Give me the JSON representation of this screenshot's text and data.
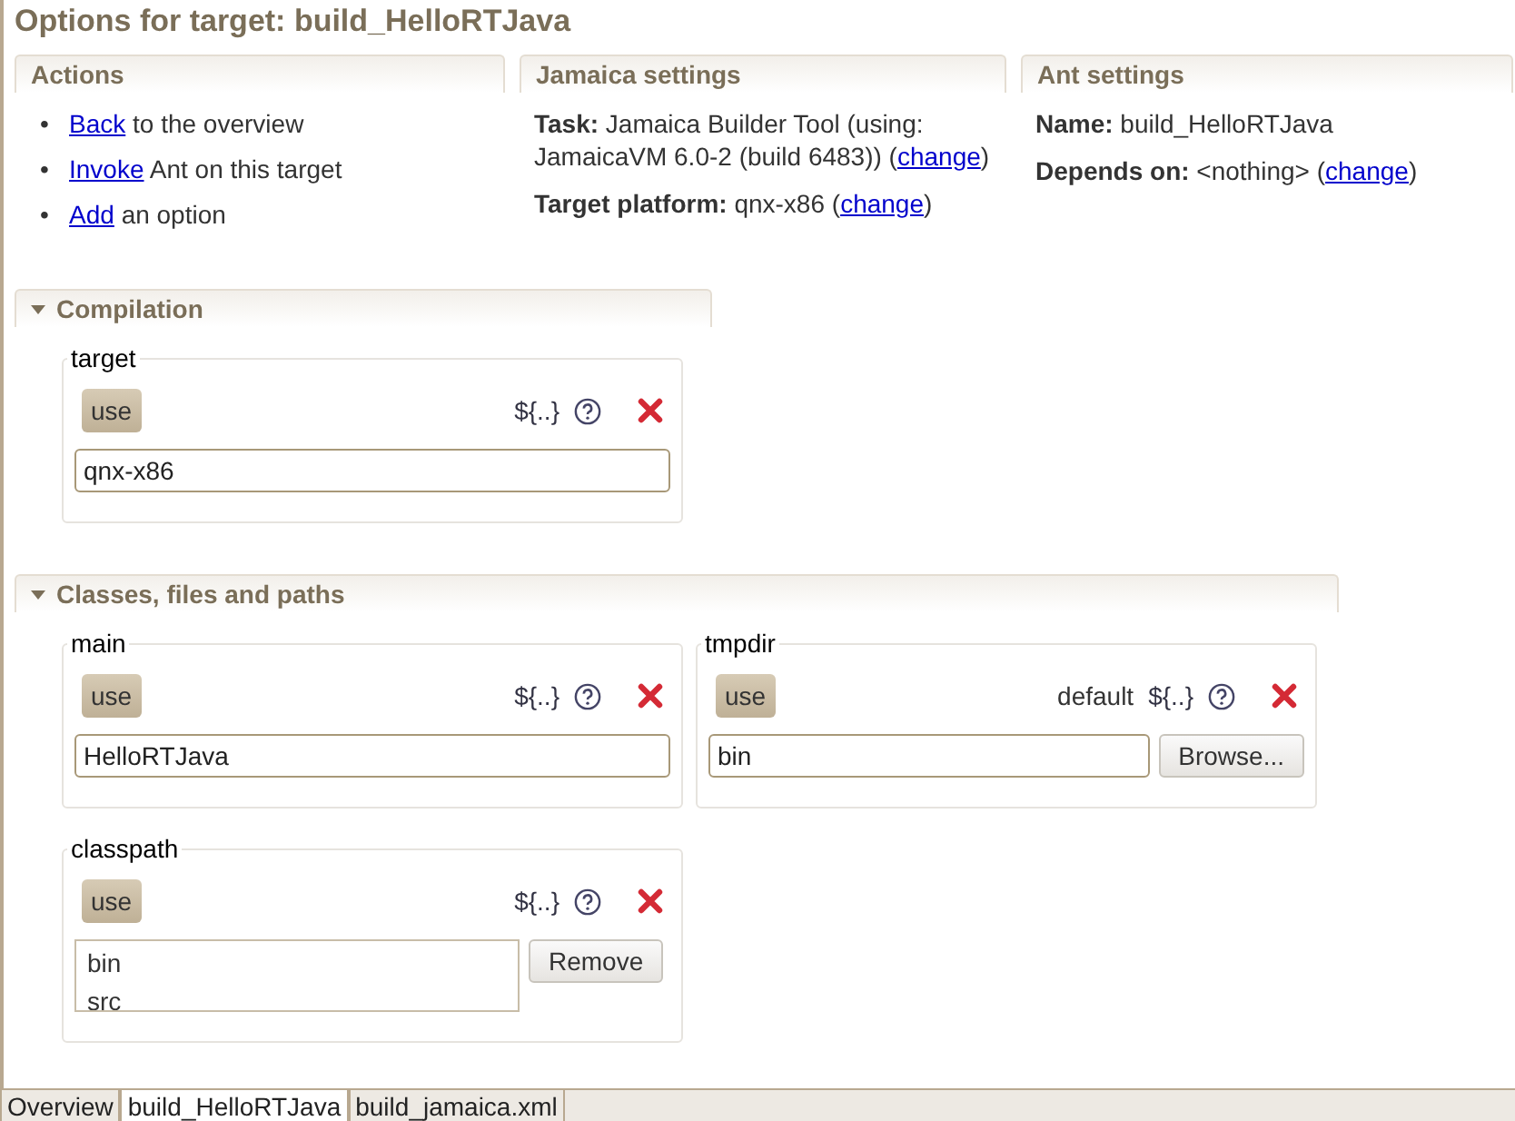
{
  "title": "Options for target: build_HelloRTJava",
  "actions": {
    "heading": "Actions",
    "items": [
      {
        "bullet": "•",
        "link": "Back",
        "text": "to the overview"
      },
      {
        "bullet": "•",
        "link": "Invoke",
        "text": "Ant on this target"
      },
      {
        "bullet": "•",
        "link": "Add",
        "text": "an option"
      }
    ]
  },
  "jamaica_settings": {
    "heading": "Jamaica settings",
    "lines": [
      {
        "text": "**Task:** Jamaica Builder Tool (using: JamaicaVM 6.0-2 (build 6483)) (",
        "link": "change",
        "after": ")"
      },
      {
        "text": "**Target platform:** qnx-x86 (",
        "link": "change",
        "after": ")"
      }
    ]
  },
  "ant_settings": {
    "heading": "Ant settings",
    "lines": [
      {
        "text": "**Name:** build_HelloRTJava"
      },
      {
        "text": "**Depends on:** <nothing> (",
        "link": "change",
        "after": ")"
      }
    ]
  },
  "sections": [
    {
      "title": "Compilation",
      "expanded": true,
      "wide": false,
      "options": [
        {
          "name": "target",
          "use": "use",
          "variable": "${..}",
          "kind": "text",
          "value": "qnx-x86"
        }
      ]
    },
    {
      "title": "Classes, files and paths",
      "expanded": true,
      "wide": true,
      "options": [
        {
          "name": "main",
          "use": "use",
          "variable": "${..}",
          "kind": "text",
          "value": "HelloRTJava"
        },
        {
          "name": "tmpdir",
          "use": "use",
          "default": "default",
          "variable": "${..}",
          "kind": "browse",
          "value": "bin",
          "button": "Browse..."
        },
        {
          "name": "classpath",
          "use": "use",
          "variable": "${..}",
          "kind": "list",
          "items": [
            "bin",
            "src"
          ],
          "button": "Remove"
        }
      ]
    }
  ],
  "tabs": [
    {
      "label": "Overview",
      "selected": false
    },
    {
      "label": "build_HelloRTJava",
      "selected": true
    },
    {
      "label": "build_jamaica.xml",
      "selected": false
    }
  ]
}
